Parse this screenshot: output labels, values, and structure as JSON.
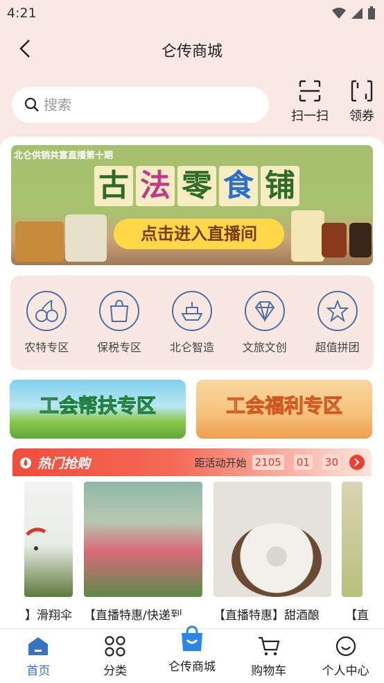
{
  "status": {
    "time": "4:21"
  },
  "header": {
    "title": "仑传商城"
  },
  "search": {
    "placeholder": "搜索"
  },
  "top_actions": [
    {
      "label": "扫一扫",
      "icon": "scan-icon"
    },
    {
      "label": "领券",
      "icon": "coupon-icon"
    }
  ],
  "banner": {
    "subtitle": "北仑供销共富直播第十期",
    "title_chars": [
      "古",
      "法",
      "零",
      "食",
      "铺"
    ],
    "cta": "点击进入直播间"
  },
  "categories": [
    {
      "label": "农特专区",
      "icon": "cherry-icon"
    },
    {
      "label": "保税专区",
      "icon": "shopping-bag-icon"
    },
    {
      "label": "北仑智造",
      "icon": "ship-icon"
    },
    {
      "label": "文旅文创",
      "icon": "diamond-icon"
    },
    {
      "label": "超值拼团",
      "icon": "star-icon"
    }
  ],
  "promos": [
    {
      "label": "工会帮扶专区"
    },
    {
      "label": "工会福利专区"
    }
  ],
  "hot": {
    "title": "热门抢购",
    "countdown_label": "距活动开始",
    "countdown": [
      "2105",
      "01",
      "30"
    ]
  },
  "products": [
    {
      "name": "】滑翔伞"
    },
    {
      "name": "【直播特惠/快递到"
    },
    {
      "name": "【直播特惠】甜酒酿"
    },
    {
      "name": "【直"
    }
  ],
  "bottom_nav": [
    {
      "label": "首页",
      "icon": "home-icon",
      "active": true
    },
    {
      "label": "分类",
      "icon": "grid-icon",
      "active": false
    },
    {
      "label": "仑传商城",
      "icon": "shopping-bag-icon",
      "active": false
    },
    {
      "label": "购物车",
      "icon": "cart-icon",
      "active": false
    },
    {
      "label": "个人中心",
      "icon": "smile-icon",
      "active": false
    }
  ],
  "colors": {
    "accent": "#3a72c4",
    "hot": "#ef4e3a",
    "header_bg": "#f9e8e3",
    "category_icon": "#4d6fa6"
  }
}
